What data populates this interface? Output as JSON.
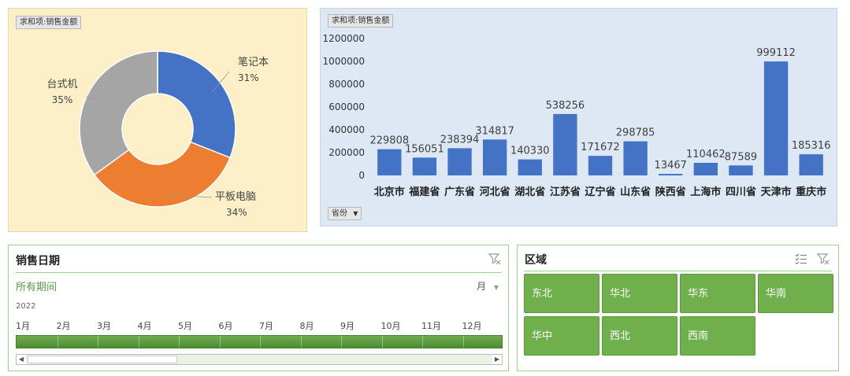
{
  "donut_chart": {
    "field_button": "求和项:销售金额",
    "chart_data": {
      "type": "pie",
      "categories": [
        "笔记本",
        "平板电脑",
        "台式机"
      ],
      "values": [
        31,
        34,
        35
      ],
      "unit": "%",
      "labels": [
        {
          "name": "笔记本",
          "pct": "31%"
        },
        {
          "name": "平板电脑",
          "pct": "34%"
        },
        {
          "name": "台式机",
          "pct": "35%"
        }
      ],
      "colors": [
        "#4472c4",
        "#ed7d31",
        "#a5a5a5"
      ]
    }
  },
  "bar_chart": {
    "field_button": "求和项:销售金额",
    "axis_button": "省份",
    "chart_data": {
      "type": "bar",
      "categories": [
        "北京市",
        "福建省",
        "广东省",
        "河北省",
        "湖北省",
        "江苏省",
        "辽宁省",
        "山东省",
        "陕西省",
        "上海市",
        "四川省",
        "天津市",
        "重庆市"
      ],
      "values": [
        229808,
        156051,
        238394,
        314817,
        140330,
        538256,
        171672,
        298785,
        13467,
        110462,
        87589,
        999112,
        185316
      ],
      "ylim": [
        0,
        1200000
      ],
      "yticks": [
        "0",
        "200000",
        "400000",
        "600000",
        "800000",
        "1000000",
        "1200000"
      ],
      "bar_color": "#4472c4",
      "grid": false
    }
  },
  "timeline": {
    "title": "销售日期",
    "period_label": "所有期间",
    "level_label": "月",
    "year": "2022",
    "months": [
      "1月",
      "2月",
      "3月",
      "4月",
      "5月",
      "6月",
      "7月",
      "8月",
      "9月",
      "10月",
      "11月",
      "12月"
    ],
    "clear_filter_icon": "clear-filter-icon",
    "accent_color": "#5a9a48"
  },
  "region_slicer": {
    "title": "区域",
    "items": [
      "东北",
      "华北",
      "华东",
      "华南",
      "华中",
      "西北",
      "西南"
    ],
    "multi_select_icon": "multi-select-icon",
    "clear_filter_icon": "clear-filter-icon",
    "button_color": "#6faf4c"
  }
}
